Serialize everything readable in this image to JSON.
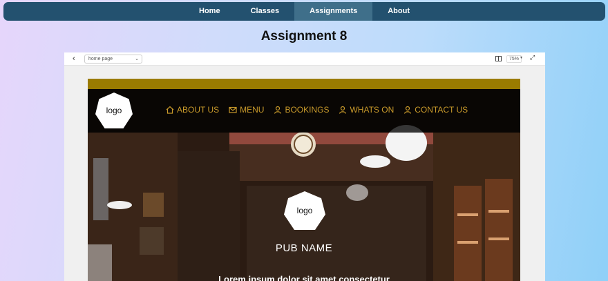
{
  "nav": {
    "items": [
      {
        "label": "Home",
        "active": false
      },
      {
        "label": "Classes",
        "active": false
      },
      {
        "label": "Assignments",
        "active": true
      },
      {
        "label": "About",
        "active": false
      }
    ]
  },
  "page_title": "Assignment 8",
  "preview": {
    "page_select": "home page",
    "zoom": "75%"
  },
  "site": {
    "logo_text": "logo",
    "nav": [
      {
        "label": "ABOUT US",
        "icon": "home-icon"
      },
      {
        "label": "MENU",
        "icon": "envelope-icon"
      },
      {
        "label": "BOOKINGS",
        "icon": "person-icon"
      },
      {
        "label": "WHATS ON",
        "icon": "person-icon"
      },
      {
        "label": "CONTACT US",
        "icon": "person-icon"
      }
    ],
    "hero_logo_text": "logo",
    "pub_name": "PUB NAME",
    "lorem": "Lorem ipsum dolor sit amet consectetur"
  },
  "colors": {
    "nav_bg": "#23516f",
    "nav_active": "#3f6f8a",
    "gold_bar": "#9a7b00",
    "site_nav_text": "#c99a2b"
  }
}
